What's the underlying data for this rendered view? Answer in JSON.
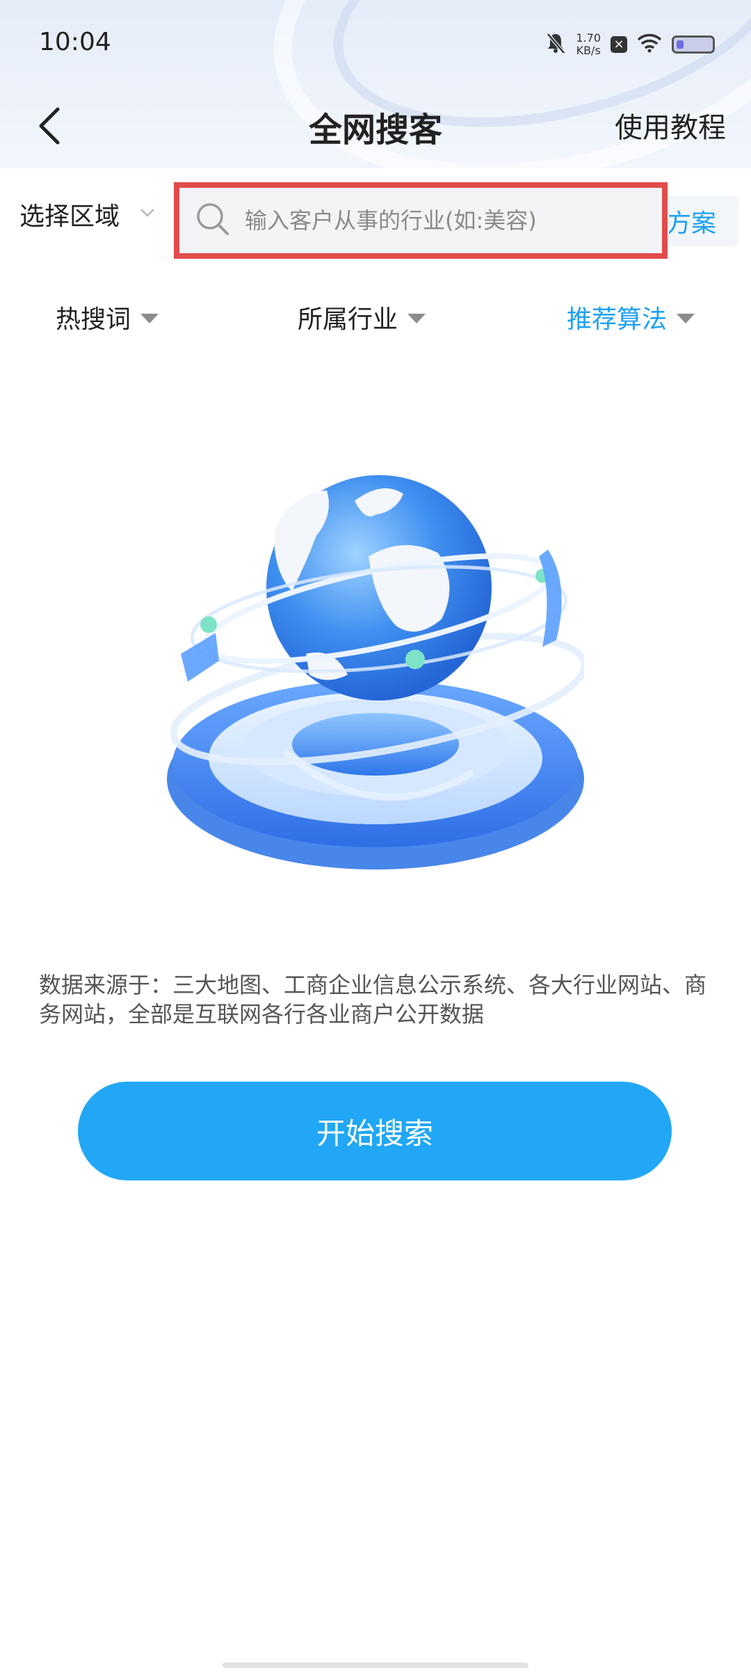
{
  "status_bar": {
    "time": "10:04",
    "net_speed_value": "1.70",
    "net_speed_unit": "KB/s",
    "icons": [
      "mute-bell-icon",
      "close-box-icon",
      "wifi-icon",
      "battery-icon"
    ]
  },
  "nav": {
    "back_icon": "chevron-left-icon",
    "title": "全网搜客",
    "tutorial_label": "使用教程"
  },
  "search": {
    "region_label": "选择区域",
    "region_icon": "chevron-down-icon",
    "search_icon": "search-icon",
    "placeholder": "输入客户从事的行业(如:美容)",
    "value": "",
    "scheme_label": "方案"
  },
  "filters": [
    {
      "label": "热搜词",
      "active": false
    },
    {
      "label": "所属行业",
      "active": false
    },
    {
      "label": "推荐算法",
      "active": true
    }
  ],
  "illustration": "globe-illustration",
  "disclaimer": "数据来源于：三大地图、工商企业信息公示系统、各大行业网站、商务网站，全部是互联网各行各业商户公开数据",
  "start_button_label": "开始搜索",
  "colors": {
    "accent": "#1da1f2",
    "button": "#21a7f5",
    "highlight_border": "#e24b4b"
  }
}
